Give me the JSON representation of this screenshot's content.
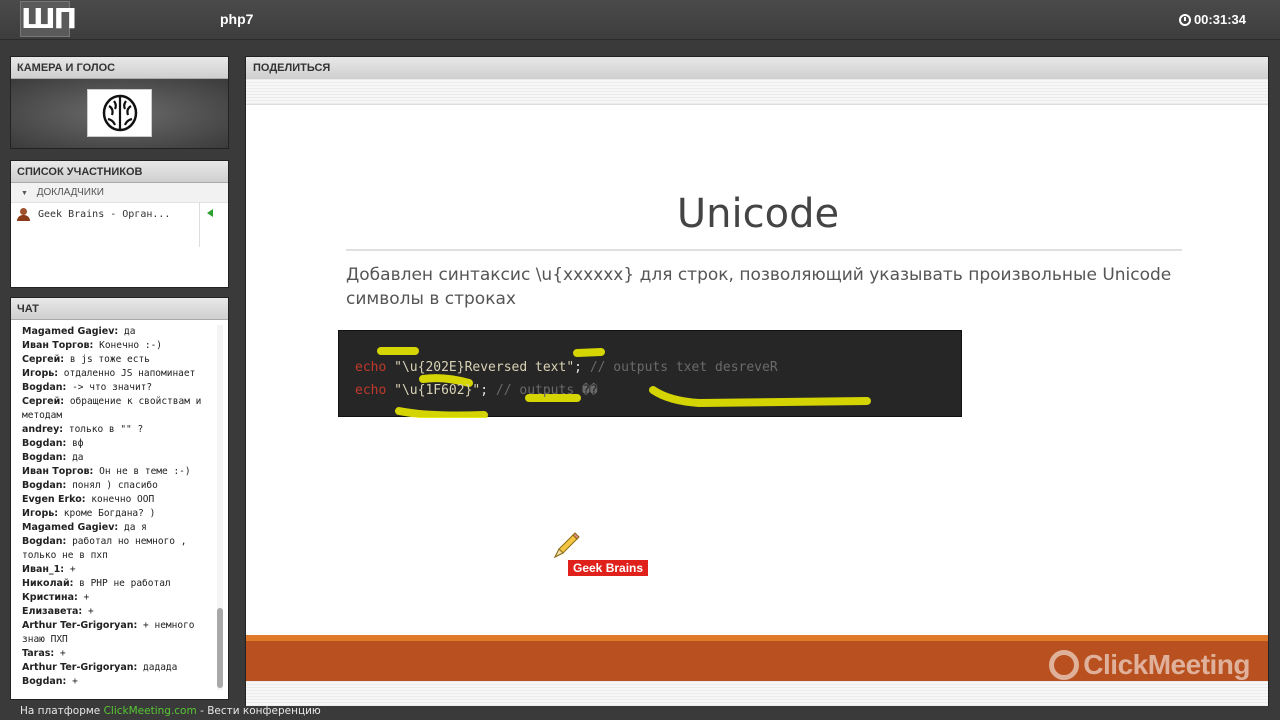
{
  "header": {
    "logo_text": "ШП",
    "room_title": "php7",
    "timer": "00:31:34"
  },
  "camera": {
    "title": "КАМЕРА И ГОЛОС"
  },
  "participants": {
    "title": "СПИСОК УЧАСТНИКОВ",
    "group_label": "ДОКЛАДЧИКИ",
    "items": [
      {
        "name": "Geek Brains - Орган..."
      }
    ]
  },
  "chat": {
    "title": "ЧАТ",
    "messages": [
      {
        "author": "Magamed Gagiev:",
        "text": "да"
      },
      {
        "author": "Иван Торгов:",
        "text": "Конечно :-)"
      },
      {
        "author": "Сергей:",
        "text": "в js тоже есть"
      },
      {
        "author": "Игорь:",
        "text": "отдаленно JS напоминает"
      },
      {
        "author": "Bogdan:",
        "text": "-> что значит?"
      },
      {
        "author": "Сергей:",
        "text": "обращение к свойствам и методам"
      },
      {
        "author": "andrey:",
        "text": "только в \"\" ?"
      },
      {
        "author": "Bogdan:",
        "text": "вф"
      },
      {
        "author": "Bogdan:",
        "text": "да"
      },
      {
        "author": "Иван Торгов:",
        "text": "Он не в теме :-)"
      },
      {
        "author": "Bogdan:",
        "text": "понял  ) спасибо"
      },
      {
        "author": "Evgen Erko:",
        "text": "конечно ООП"
      },
      {
        "author": "Игорь:",
        "text": "кроме Богдана? )"
      },
      {
        "author": "Magamed Gagiev:",
        "text": "да я"
      },
      {
        "author": "Bogdan:",
        "text": "работал но немного , только не в пхп"
      },
      {
        "author": "Иван_1:",
        "text": "+"
      },
      {
        "author": "Николай:",
        "text": "в PHP не работал"
      },
      {
        "author": "Кристина:",
        "text": "+"
      },
      {
        "author": "Елизавета:",
        "text": "+"
      },
      {
        "author": "Arthur Ter-Grigoryan:",
        "text": "+ немного знаю ПХП"
      },
      {
        "author": "Taras:",
        "text": "+"
      },
      {
        "author": "Arthur Ter-Grigoryan:",
        "text": "дадада"
      },
      {
        "author": "Bogdan:",
        "text": "+"
      }
    ]
  },
  "share": {
    "title": "ПОДЕЛИТЬСЯ",
    "slide_title": "Unicode",
    "slide_text": "Добавлен синтаксис \\u{xxxxxx} для строк, позволяющий указывать произвольные Unicode символы в строках",
    "code": {
      "line1_keyword": "echo",
      "line1_string": "\"\\u{202E}Reversed text\"",
      "line1_semicolon": ";",
      "line1_comment": "// outputs txet desreveR",
      "line2_keyword": "echo",
      "line2_string": "\"\\u{1F602}\"",
      "line2_semicolon": ";",
      "line2_comment": "// outputs ��"
    },
    "pointer_label": "Geek Brains",
    "watermark": "ClickMeeting",
    "colors": {
      "footer_orange": "#b8501f",
      "highlight_yellow": "#f0f000",
      "pointer_red": "#e0201a"
    }
  },
  "status_bar": {
    "prefix": "На платформе",
    "link": "ClickMeeting.com",
    "suffix": "- Вести конференцию"
  }
}
